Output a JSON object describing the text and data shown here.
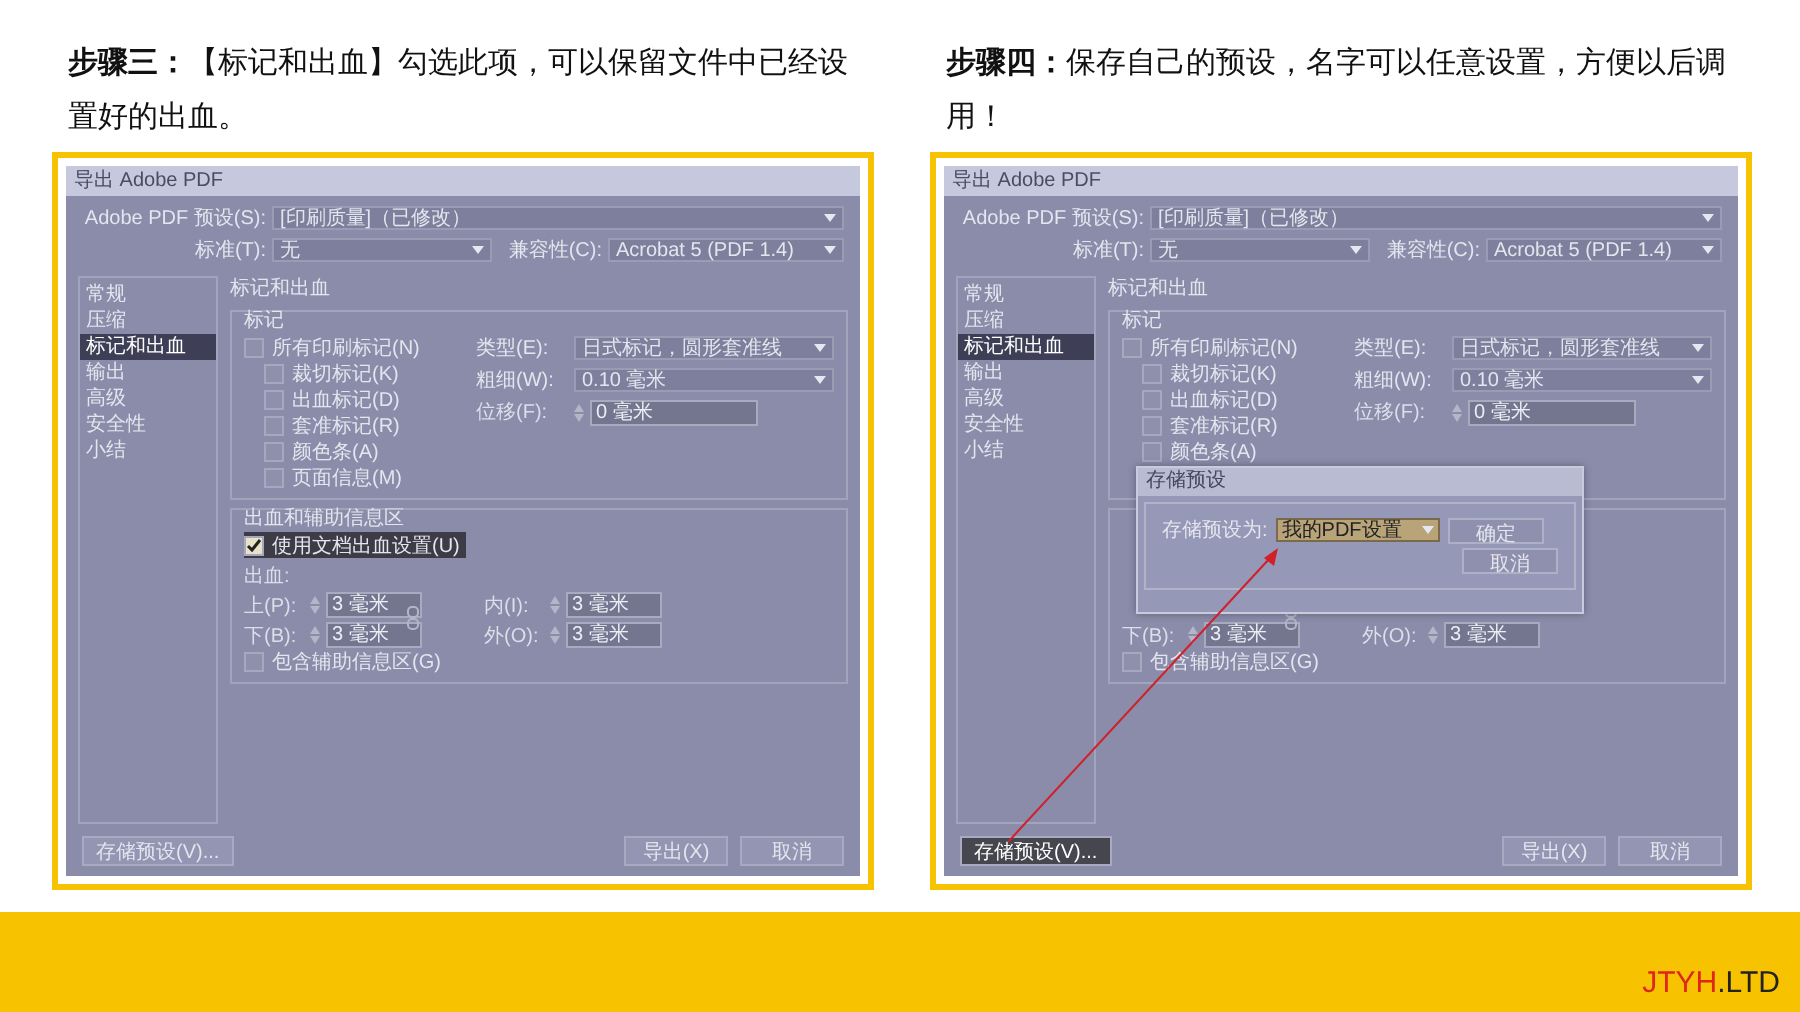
{
  "panels": [
    {
      "caption": "**步骤三：**【标记和出血】勾选此项，可以保留文件中已经设置好的出血。",
      "dialog": {
        "title": "导出 Adobe PDF",
        "preset": {
          "label": "Adobe PDF 预设(S):",
          "value": "[印刷质量]（已修改）"
        },
        "standard": {
          "label": "标准(T):",
          "value": "无"
        },
        "compat": {
          "label": "兼容性(C):",
          "value": "Acrobat 5 (PDF 1.4)"
        },
        "sidebar": [
          {
            "label": "常规",
            "selected": false
          },
          {
            "label": "压缩",
            "selected": false
          },
          {
            "label": "标记和出血",
            "selected": true
          },
          {
            "label": "输出",
            "selected": false
          },
          {
            "label": "高级",
            "selected": false
          },
          {
            "label": "安全性",
            "selected": false
          },
          {
            "label": "小结",
            "selected": false
          }
        ],
        "section_title": "标记和出血",
        "marks": {
          "label": "标记",
          "items": [
            {
              "label": "所有印刷标记(N)",
              "checked": false,
              "children": [
                {
                  "label": "裁切标记(K)",
                  "checked": false
                },
                {
                  "label": "出血标记(D)",
                  "checked": false
                },
                {
                  "label": "套准标记(R)",
                  "checked": false
                },
                {
                  "label": "颜色条(A)",
                  "checked": false
                },
                {
                  "label": "页面信息(M)",
                  "checked": false
                }
              ]
            }
          ],
          "type": {
            "label": "类型(E):",
            "value": "日式标记，圆形套准线"
          },
          "weight": {
            "label": "粗细(W):",
            "value": "0.10 毫米"
          },
          "offset": {
            "label": "位移(F):",
            "value": "0 毫米"
          }
        },
        "bleed": {
          "label": "出血和辅助信息区",
          "use_doc": {
            "label": "使用文档出血设置(U)",
            "checked": true
          },
          "caption": "出血:",
          "rows": [
            [
              {
                "label": "上(P):",
                "value": "3 毫米"
              },
              {
                "label": "内(I):",
                "value": "3 毫米"
              }
            ],
            [
              {
                "label": "下(B):",
                "value": "3 毫米"
              },
              {
                "label": "外(O):",
                "value": "3 毫米"
              }
            ]
          ],
          "include": {
            "label": "包含辅助信息区(G)",
            "checked": false
          }
        },
        "buttons": [
          {
            "label": "存储预设(V)...",
            "kind": "left",
            "highlighted": false
          },
          {
            "label": "导出(X)",
            "kind": "right",
            "highlighted": false
          },
          {
            "label": "取消",
            "kind": "right",
            "highlighted": false
          }
        ]
      }
    },
    {
      "caption": "**步骤四：**保存自己的预设，名字可以任意设置，方便以后调用！",
      "dialog": {
        "title": "导出 Adobe PDF",
        "preset": {
          "label": "Adobe PDF 预设(S):",
          "value": "[印刷质量]（已修改）"
        },
        "standard": {
          "label": "标准(T):",
          "value": "无"
        },
        "compat": {
          "label": "兼容性(C):",
          "value": "Acrobat 5 (PDF 1.4)"
        },
        "sidebar": [
          {
            "label": "常规",
            "selected": false
          },
          {
            "label": "压缩",
            "selected": false
          },
          {
            "label": "标记和出血",
            "selected": true
          },
          {
            "label": "输出",
            "selected": false
          },
          {
            "label": "高级",
            "selected": false
          },
          {
            "label": "安全性",
            "selected": false
          },
          {
            "label": "小结",
            "selected": false
          }
        ],
        "section_title": "标记和出血",
        "marks": {
          "label": "标记",
          "items": [
            {
              "label": "所有印刷标记(N)",
              "checked": false,
              "children": [
                {
                  "label": "裁切标记(K)",
                  "checked": false
                },
                {
                  "label": "出血标记(D)",
                  "checked": false
                },
                {
                  "label": "套准标记(R)",
                  "checked": false
                },
                {
                  "label": "颜色条(A)",
                  "checked": false
                }
              ]
            }
          ],
          "type": {
            "label": "类型(E):",
            "value": "日式标记，圆形套准线"
          },
          "weight": {
            "label": "粗细(W):",
            "value": "0.10 毫米"
          },
          "offset": {
            "label": "位移(F):",
            "value": "0 毫米"
          }
        },
        "bleed": {
          "rows": [
            [
              {
                "label": "下(B):",
                "value": "3 毫米"
              },
              {
                "label": "外(O):",
                "value": "3 毫米"
              }
            ]
          ],
          "include": {
            "label": "包含辅助信息区(G)",
            "checked": false
          }
        },
        "buttons": [
          {
            "label": "存储预设(V)...",
            "kind": "left",
            "highlighted": true
          },
          {
            "label": "导出(X)",
            "kind": "right",
            "highlighted": false
          },
          {
            "label": "取消",
            "kind": "right",
            "highlighted": false
          }
        ],
        "overlay": {
          "title": "存储预设",
          "label": "存储预设为:",
          "value": "我的PDF设置",
          "ok": "确定",
          "cancel": "取消"
        }
      }
    }
  ],
  "footer": {
    "logo_accent": "JTYH",
    "logo_rest": ".LTD"
  }
}
